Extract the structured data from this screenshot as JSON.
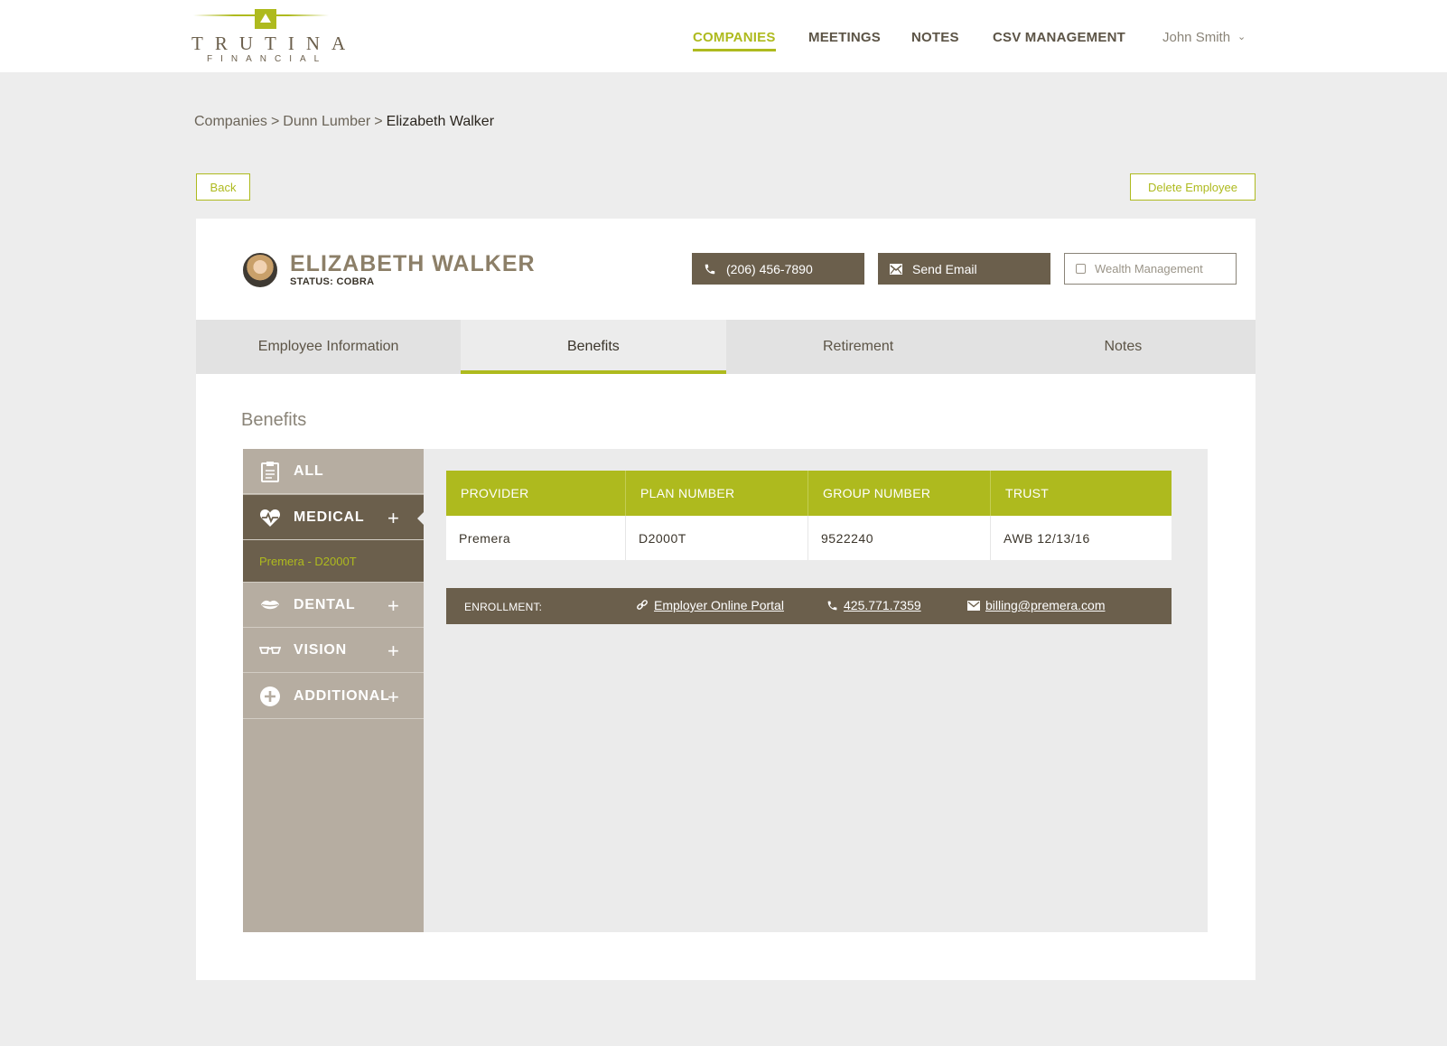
{
  "colors": {
    "accent": "#aeba1e",
    "brown": "#6b5f4c",
    "taupe": "#b6ada1",
    "page_bg": "#ededed"
  },
  "brand": {
    "name": "TRUTINA",
    "sub": "FINANCIAL"
  },
  "nav": {
    "items": [
      "COMPANIES",
      "MEETINGS",
      "NOTES",
      "CSV MANAGEMENT"
    ],
    "active": "COMPANIES",
    "user": "John Smith"
  },
  "breadcrumb": {
    "items": [
      "Companies",
      "Dunn Lumber",
      "Elizabeth Walker"
    ],
    "separator": ">"
  },
  "actions": {
    "back": "Back",
    "delete": "Delete Employee"
  },
  "employee": {
    "name": "ELIZABETH WALKER",
    "status": "STATUS: COBRA",
    "phone": "(206) 456-7890",
    "email_button": "Send Email",
    "wealth_management": "Wealth Management"
  },
  "tabs": [
    "Employee Information",
    "Benefits",
    "Retirement",
    "Notes"
  ],
  "active_tab": "Benefits",
  "benefits": {
    "title": "Benefits",
    "categories": [
      {
        "label": "ALL",
        "icon": "clipboard-icon"
      },
      {
        "label": "MEDICAL",
        "icon": "heart-pulse-icon",
        "active": true,
        "sub": "Premera - D2000T"
      },
      {
        "label": "DENTAL",
        "icon": "lips-icon"
      },
      {
        "label": "VISION",
        "icon": "glasses-icon"
      },
      {
        "label": "ADDITIONAL",
        "icon": "plus-circle-icon"
      }
    ],
    "plus": "+",
    "table": {
      "headers": [
        "PROVIDER",
        "PLAN NUMBER",
        "GROUP NUMBER",
        "TRUST"
      ],
      "rows": [
        [
          "Premera",
          "D2000T",
          "9522240",
          "AWB 12/13/16"
        ]
      ]
    },
    "enrollment": {
      "label": "ENROLLMENT:",
      "portal": "Employer Online Portal",
      "phone": "425.771.7359",
      "email": "billing@premera.com"
    }
  }
}
